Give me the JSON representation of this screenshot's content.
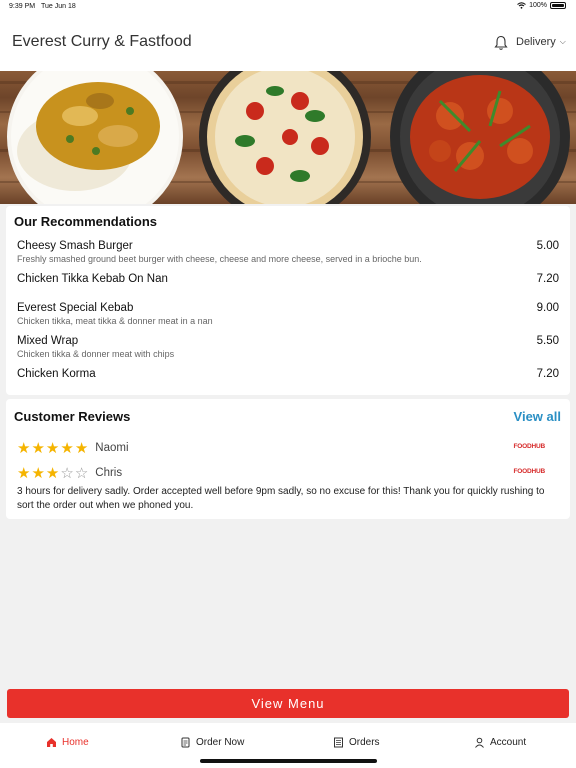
{
  "status_bar": {
    "time": "9:39 PM",
    "date": "Tue Jun 18",
    "battery": "100%"
  },
  "header": {
    "title": "Everest Curry & Fastfood",
    "delivery_mode": "Delivery",
    "bell_icon": "bell-icon",
    "chevron_icon": "chevron-down-icon"
  },
  "recommendations": {
    "title": "Our Recommendations",
    "items": [
      {
        "name": "Cheesy Smash Burger",
        "description": "Freshly smashed ground beet burger with cheese, cheese and more cheese, served in a brioche bun.",
        "price": "5.00"
      },
      {
        "name": "Chicken Tikka Kebab On Nan",
        "description": "",
        "price": "7.20"
      },
      {
        "name": "Everest Special Kebab",
        "description": "Chicken tikka, meat tikka & donner meat in a nan",
        "price": "9.00"
      },
      {
        "name": "Mixed Wrap",
        "description": "Chicken tikka & donner meat with chips",
        "price": "5.50"
      },
      {
        "name": "Chicken Korma",
        "description": "",
        "price": "7.20"
      }
    ]
  },
  "reviews": {
    "title": "Customer Reviews",
    "view_all": "View all",
    "items": [
      {
        "name": "Naomi",
        "rating": 5,
        "source": "FOODHUB"
      },
      {
        "name": "Chris",
        "rating": 3,
        "source": "FOODHUB",
        "text": "3 hours for delivery sadly. Order accepted well before 9pm sadly, so no excuse for this! Thank you for quickly rushing to sort the order out when we phoned you."
      }
    ]
  },
  "view_menu_label": "View Menu",
  "tabs": [
    {
      "label": "Home",
      "icon": "home-icon",
      "active": true
    },
    {
      "label": "Order Now",
      "icon": "order-icon",
      "active": false
    },
    {
      "label": "Orders",
      "icon": "receipt-icon",
      "active": false
    },
    {
      "label": "Account",
      "icon": "user-icon",
      "active": false
    }
  ],
  "colors": {
    "accent": "#e8312b",
    "link": "#2a8fc4",
    "star": "#f5b400"
  }
}
